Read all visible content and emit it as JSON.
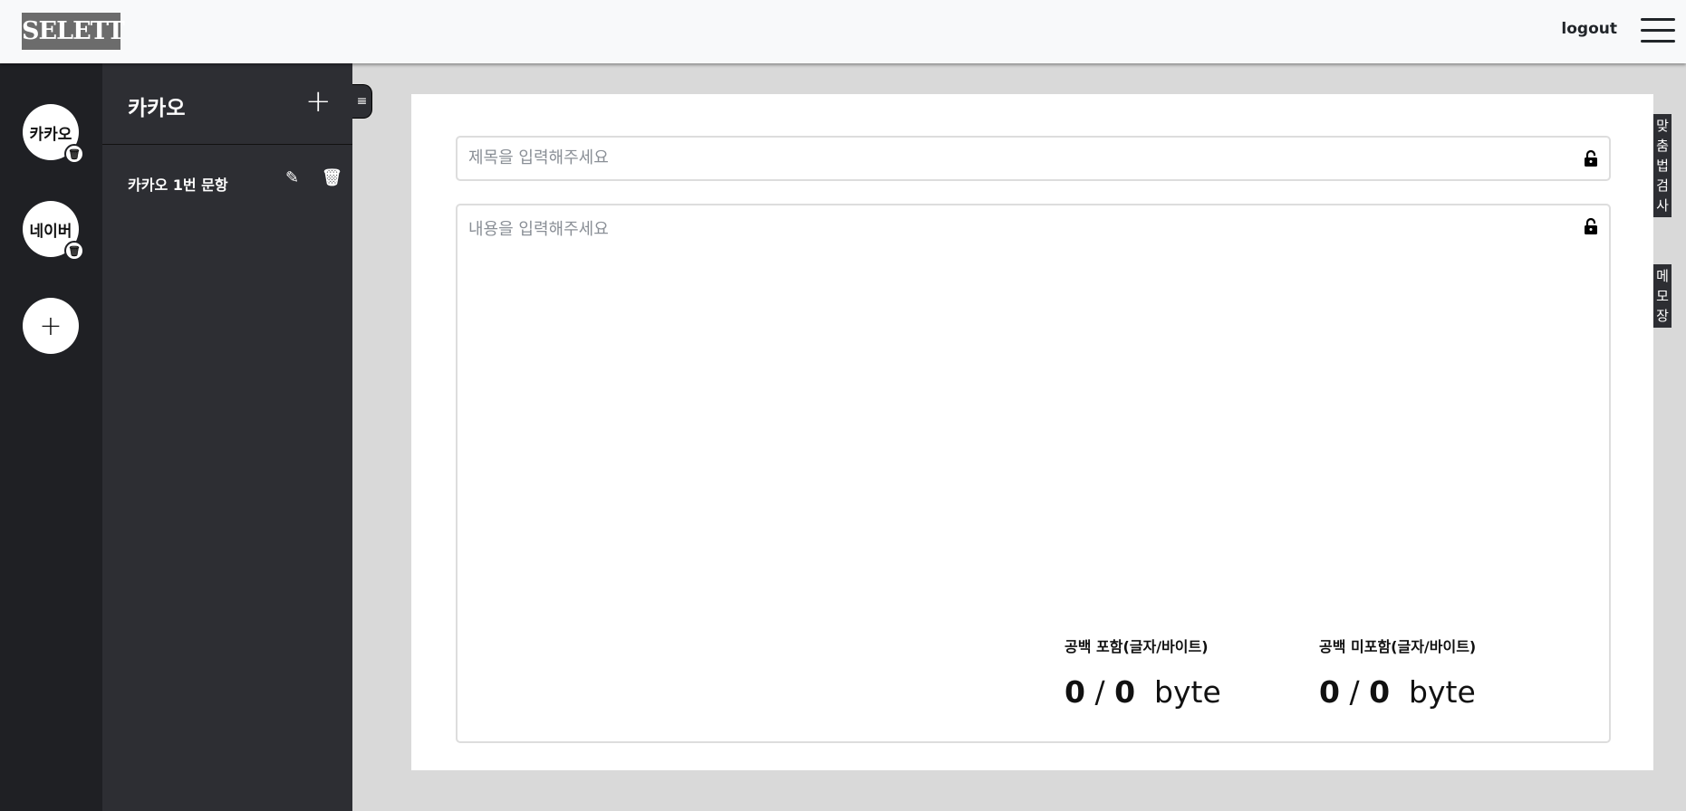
{
  "header": {
    "logo": "SELETT",
    "logout": "logout"
  },
  "rail": {
    "items": [
      {
        "label": "카카오"
      },
      {
        "label": "네이버"
      }
    ],
    "add": "+"
  },
  "panel": {
    "title": "카카오",
    "add": "+",
    "items": [
      {
        "label": "카카오 1번 문항"
      }
    ]
  },
  "editor": {
    "title_placeholder": "제목을 입력해주세요",
    "content_placeholder": "내용을 입력해주세요",
    "stats": [
      {
        "label": "공백 포함(글자/바이트)",
        "chars": "0",
        "bytes": "0",
        "unit": "byte"
      },
      {
        "label": "공백 미포함(글자/바이트)",
        "chars": "0",
        "bytes": "0",
        "unit": "byte"
      }
    ]
  },
  "sidetabs": {
    "spell": "맞춤법검사",
    "memo": "메모장"
  }
}
